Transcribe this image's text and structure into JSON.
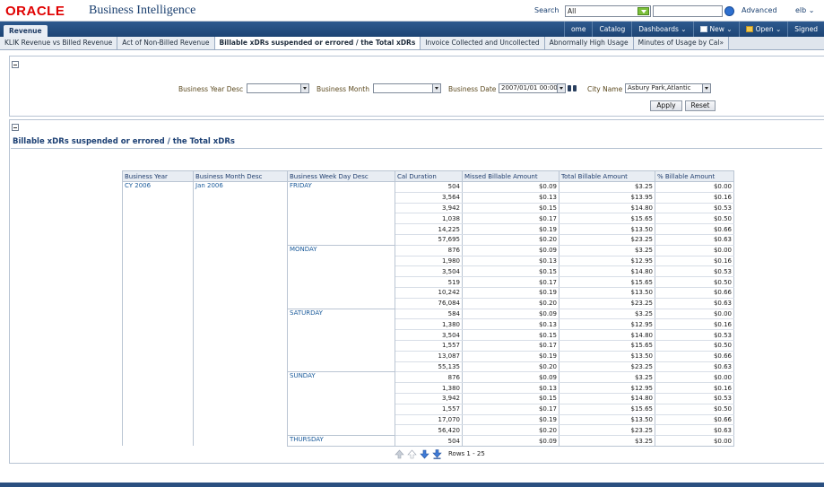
{
  "header": {
    "logo": "ORACLE",
    "app_title": "Business Intelligence",
    "search_label": "Search",
    "search_scope": "All",
    "advanced_label": "Advanced",
    "user_label": "elb ⌄"
  },
  "nav": {
    "active_tab": "Revenue",
    "links": [
      {
        "label": "ome",
        "icon": ""
      },
      {
        "label": "Catalog",
        "icon": ""
      },
      {
        "label": "Dashboards ⌄",
        "icon": ""
      },
      {
        "label": "New ⌄",
        "icon": "new-icon"
      },
      {
        "label": "Open ⌄",
        "icon": "folder-icon"
      },
      {
        "label": "Signed",
        "icon": ""
      }
    ]
  },
  "page_tabs": [
    {
      "label": "KLIK Revenue vs Billed Revenue",
      "active": false
    },
    {
      "label": "Act of Non-Billed Revenue",
      "active": false
    },
    {
      "label": "Billable xDRs suspended or errored / the Total xDRs",
      "active": true
    },
    {
      "label": "Invoice Collected and Uncollected",
      "active": false
    },
    {
      "label": "Abnormally High Usage",
      "active": false
    },
    {
      "label": "Minutes of Usage by Cal»",
      "active": false
    }
  ],
  "prompts": {
    "business_year_desc_label": "Business Year Desc",
    "business_year_desc_value": "",
    "business_month_label": "Business Month",
    "business_month_value": "",
    "business_date_label": "Business Date",
    "business_date_value": "2007/01/01 00:00",
    "city_name_label": "City Name",
    "city_name_value": "Asbury Park,Atlantic",
    "apply_label": "Apply",
    "reset_label": "Reset"
  },
  "report": {
    "title": "Billable xDRs suspended or errored / the Total xDRs",
    "columns": [
      "Business Year",
      "Business Month Desc",
      "Business Week Day Desc",
      "Cal Duration",
      "Missed Billable Amount",
      "Total Billable Amount",
      "% Billable Amount"
    ],
    "business_year": "CY 2006",
    "business_month": "Jan 2006",
    "groups": [
      {
        "weekday": "FRIDAY",
        "rows": [
          [
            "504",
            "$0.09",
            "$3.25",
            "$0.00"
          ],
          [
            "3,564",
            "$0.13",
            "$13.95",
            "$0.16"
          ],
          [
            "3,942",
            "$0.15",
            "$14.80",
            "$0.53"
          ],
          [
            "1,038",
            "$0.17",
            "$15.65",
            "$0.50"
          ],
          [
            "14,225",
            "$0.19",
            "$13.50",
            "$0.66"
          ],
          [
            "57,695",
            "$0.20",
            "$23.25",
            "$0.63"
          ]
        ]
      },
      {
        "weekday": "MONDAY",
        "rows": [
          [
            "876",
            "$0.09",
            "$3.25",
            "$0.00"
          ],
          [
            "1,980",
            "$0.13",
            "$12.95",
            "$0.16"
          ],
          [
            "3,504",
            "$0.15",
            "$14.80",
            "$0.53"
          ],
          [
            "519",
            "$0.17",
            "$15.65",
            "$0.50"
          ],
          [
            "10,242",
            "$0.19",
            "$13.50",
            "$0.66"
          ],
          [
            "76,084",
            "$0.20",
            "$23.25",
            "$0.63"
          ]
        ]
      },
      {
        "weekday": "SATURDAY",
        "rows": [
          [
            "584",
            "$0.09",
            "$3.25",
            "$0.00"
          ],
          [
            "1,380",
            "$0.13",
            "$12.95",
            "$0.16"
          ],
          [
            "3,504",
            "$0.15",
            "$14.80",
            "$0.53"
          ],
          [
            "1,557",
            "$0.17",
            "$15.65",
            "$0.50"
          ],
          [
            "13,087",
            "$0.19",
            "$13.50",
            "$0.66"
          ],
          [
            "55,135",
            "$0.20",
            "$23.25",
            "$0.63"
          ]
        ]
      },
      {
        "weekday": "SUNDAY",
        "rows": [
          [
            "876",
            "$0.09",
            "$3.25",
            "$0.00"
          ],
          [
            "1,380",
            "$0.13",
            "$12.95",
            "$0.16"
          ],
          [
            "3,942",
            "$0.15",
            "$14.80",
            "$0.53"
          ],
          [
            "1,557",
            "$0.17",
            "$15.65",
            "$0.50"
          ],
          [
            "17,070",
            "$0.19",
            "$13.50",
            "$0.66"
          ],
          [
            "56,420",
            "$0.20",
            "$23.25",
            "$0.63"
          ]
        ]
      },
      {
        "weekday": "THURSDAY",
        "rows": [
          [
            "504",
            "$0.09",
            "$3.25",
            "$0.00"
          ]
        ]
      }
    ],
    "rows_label": "Rows 1 - 25"
  },
  "colors": {
    "brand_red": "#e00000",
    "nav_blue": "#1d4474",
    "link_blue": "#1a5a9a",
    "go_green": "#7cbf3a"
  }
}
